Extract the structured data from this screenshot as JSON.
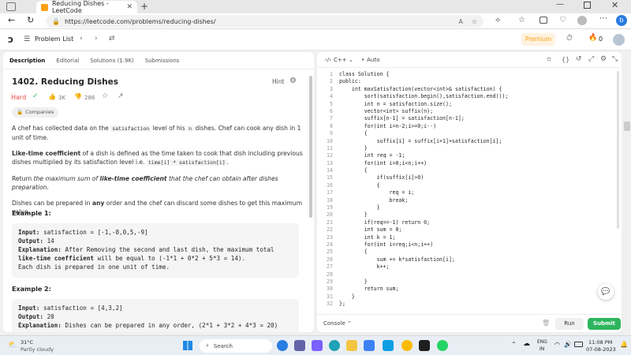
{
  "browser": {
    "tab_title": "Reducing Dishes - LeetCode",
    "url": "https://leetcode.com/problems/reducing-dishes/"
  },
  "header": {
    "problem_list": "Problem List",
    "premium": "Premium",
    "notifications": "0"
  },
  "left_tabs": [
    "Description",
    "Editorial",
    "Solutions (1.9K)",
    "Submissions"
  ],
  "problem": {
    "title": "1402. Reducing Dishes",
    "hint": "Hint",
    "difficulty": "Hard",
    "likes": "3K",
    "dislikes": "286",
    "companies": "Companies",
    "p1a": "A chef has collected data on the ",
    "p1code": "satisfaction",
    "p1b": " level of his ",
    "p1n": "n",
    "p1c": " dishes. Chef can cook any dish in 1 unit of time.",
    "p2bold": "Like-time coefficient",
    "p2a": " of a dish is defined as the time taken to cook that dish including previous dishes multiplied by its satisfaction level i.e. ",
    "p2code": "time[i] * satisfaction[i]",
    "p2b": ".",
    "p3a": "Return ",
    "p3i1": "the maximum sum of ",
    "p3bold": "like-time coefficient",
    "p3i2": " that the chef can obtain after dishes preparation",
    "p3b": ".",
    "p4a": "Dishes can be prepared in ",
    "p4bold": "any",
    "p4b": " order and the chef can discard some dishes to get this maximum value.",
    "ex1_title": "Example 1:",
    "ex1_input_label": "Input:",
    "ex1_input": " satisfaction = [-1,-8,0,5,-9]",
    "ex1_output_label": "Output:",
    "ex1_output": " 14",
    "ex1_expl_label": "Explanation:",
    "ex1_expl_a": " After Removing the second and last dish, the maximum total ",
    "ex1_expl_bold": "like-time coefficient",
    "ex1_expl_b": " will be equal to (-1*1 + 0*2 + 5*3 = 14).",
    "ex1_expl_c": "Each dish is prepared in one unit of time.",
    "ex2_title": "Example 2:",
    "ex2_input_label": "Input:",
    "ex2_input": " satisfaction = [4,3,2]",
    "ex2_output_label": "Output:",
    "ex2_output": " 20",
    "ex2_expl_label": "Explanation:",
    "ex2_expl": " Dishes can be prepared in any order, (2*1 + 3*2 + 4*3 = 20)"
  },
  "editor": {
    "language": "C++",
    "auto": "Auto",
    "console": "Console",
    "run": "Run",
    "submit": "Submit",
    "lines": [
      "class Solution {",
      "public:",
      "    int maxSatisfaction(vector<int>& satisfaction) {",
      "        sort(satisfaction.begin(),satisfaction.end());",
      "        int n = satisfaction.size();",
      "        vector<int> suffix(n);",
      "        suffix[n-1] = satisfaction[n-1];",
      "        for(int i=n-2;i>=0;i--)",
      "        {",
      "            suffix[i] = suffix[i+1]+satisfaction[i];",
      "        }",
      "        int req = -1;",
      "        for(int i=0;i<n;i++)",
      "        {",
      "            if(suffix[i]>0)",
      "            {",
      "                req = i;",
      "                break;",
      "            }",
      "        }",
      "        if(req==-1) return 0;",
      "        int sum = 0;",
      "        int k = 1;",
      "        for(int i=req;i<n;i++)",
      "        {",
      "            sum += k*satisfaction[i];",
      "            k++;",
      "",
      "        }",
      "        return sum;",
      "    }",
      "};"
    ]
  },
  "taskbar": {
    "weather_temp": "31°C",
    "weather_desc": "Partly cloudy",
    "search": "Search",
    "lang1": "ENG",
    "lang2": "IN",
    "time": "11:08 PM",
    "date": "07-08-2023"
  },
  "colors": {
    "hard": "#ef4743",
    "submit": "#2db55d",
    "premium": "#ffa116"
  }
}
